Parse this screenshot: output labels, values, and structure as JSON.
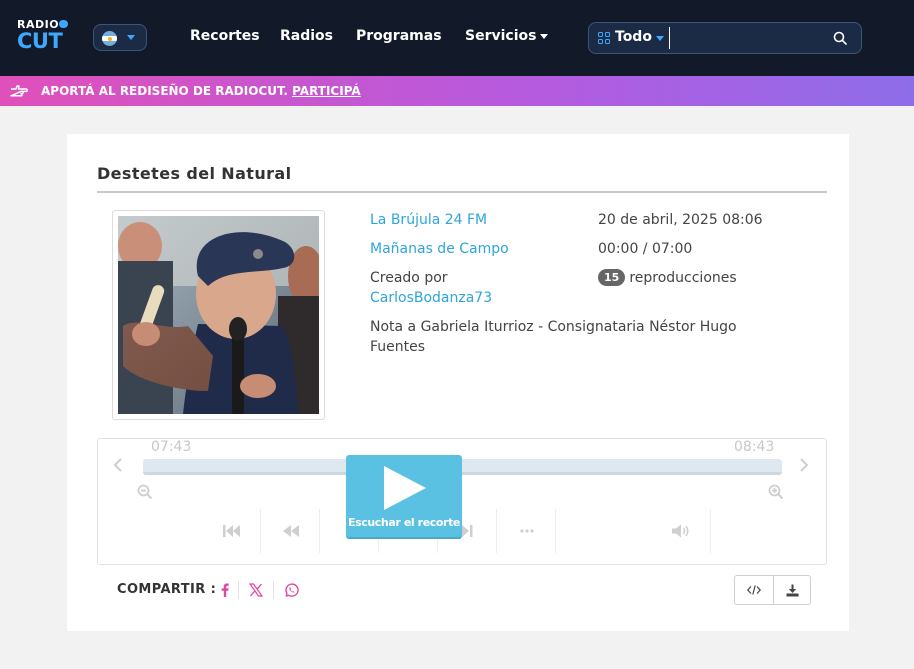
{
  "header": {
    "logo_top": "RADIO",
    "logo_bottom": "CUT",
    "nav": [
      {
        "label": "Recortes"
      },
      {
        "label": "Radios"
      },
      {
        "label": "Programas"
      },
      {
        "label": "Servicios"
      }
    ],
    "search": {
      "scope": "Todo",
      "value": "",
      "placeholder": ""
    }
  },
  "banner": {
    "text": "APORTÁ AL REDISEÑO DE RADIOCUT.",
    "link": "PARTICIPÁ"
  },
  "clip": {
    "title": "Destetes del Natural",
    "radio": "La Brújula 24 FM",
    "program": "Mañanas de Campo",
    "created_by_label": "Creado por",
    "creator": "CarlosBodanza73",
    "date": "20 de abril, 2025 08:06",
    "duration": "00:00 / 07:00",
    "plays_count": "15",
    "plays_label": "reproducciones",
    "description_line1": "Nota a Gabriela Iturrioz - Consignataria Néstor Hugo",
    "description_line2": "Fuentes"
  },
  "player": {
    "start_time": "07:43",
    "end_time": "08:43",
    "play_label": "Escuchar el recorte"
  },
  "share": {
    "label": "COMPARTIR :"
  },
  "colors": {
    "header_bg": "#121a29",
    "accent_blue": "#3da8ff",
    "link": "#2ea5dc",
    "play_button": "#5bc1e3",
    "share_icon": "#e0479e"
  }
}
